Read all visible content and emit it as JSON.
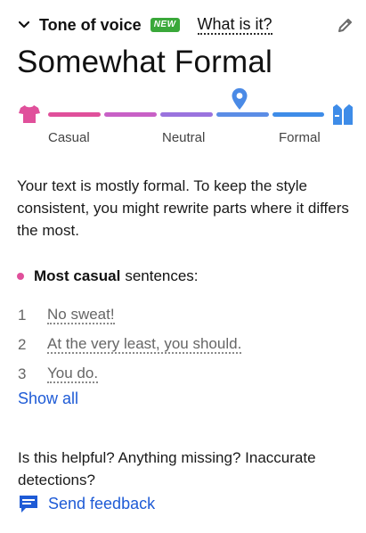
{
  "header": {
    "title": "Tone of voice",
    "badge": "NEW",
    "info_link": "What is it?"
  },
  "tone": {
    "title": "Somewhat Formal",
    "labels": {
      "casual": "Casual",
      "neutral": "Neutral",
      "formal": "Formal"
    },
    "scale_position_fraction": 0.75,
    "colors": [
      "#e0509b",
      "#c860c6",
      "#9a73de",
      "#5b8de6",
      "#3e8ce8"
    ]
  },
  "description": "Your text is mostly formal. To keep the style consistent, you might rewrite parts where it differs the most.",
  "section": {
    "bold": "Most casual",
    "rest": "sentences:"
  },
  "sentences": [
    {
      "num": "1",
      "text": "No sweat!"
    },
    {
      "num": "2",
      "text": "At the very least, you should."
    },
    {
      "num": "3",
      "text": "You do."
    }
  ],
  "show_all": "Show all",
  "helpful": "Is this helpful? Anything missing? Inaccurate detections?",
  "feedback": "Send feedback"
}
